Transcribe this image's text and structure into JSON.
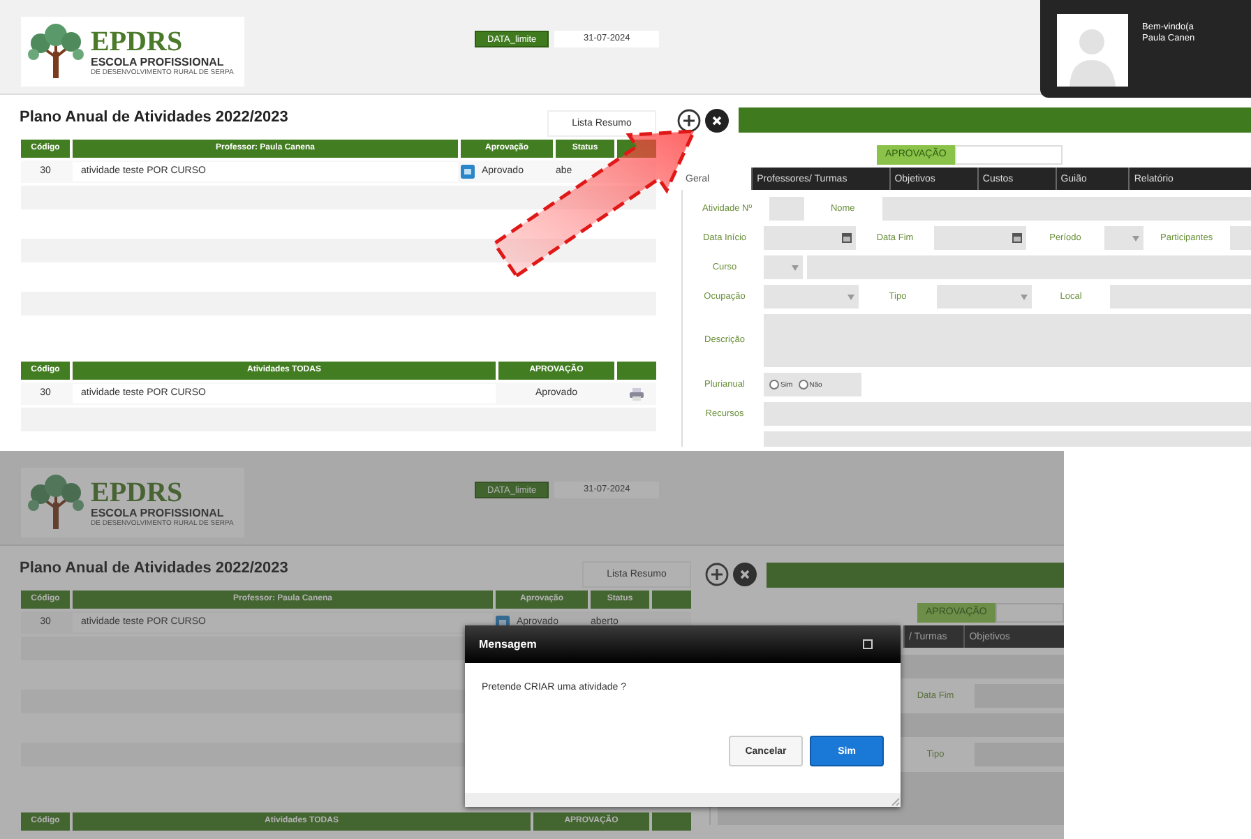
{
  "screens": [
    {
      "header": {
        "logo": {
          "name": "EPDRS",
          "subtitle": "ESCOLA PROFISSIONAL",
          "tagline": "DE DESENVOLVIMENTO RURAL DE SERPA"
        },
        "date_label": "DATA_limite",
        "date_value": "31-07-2024",
        "user": {
          "greeting": "Bem-vindo(a",
          "name": "Paula Canen"
        }
      },
      "title": "Plano Anual de Atividades 2022/2023",
      "summary_button": "Lista Resumo",
      "activities_table": {
        "columns": [
          "Código",
          "Professor: Paula Canena",
          "Aprovação",
          "Status"
        ],
        "rows": [
          {
            "code": "30",
            "name": "atividade teste POR CURSO",
            "approval": "Aprovado",
            "status": "abe"
          }
        ]
      },
      "all_table": {
        "columns": [
          "Código",
          "Atividades TODAS",
          "APROVAÇÃO"
        ],
        "rows": [
          {
            "code": "30",
            "name": "atividade teste POR CURSO",
            "approval": "Aprovado"
          }
        ]
      },
      "form": {
        "badge": "APROVAÇÃO",
        "tabs": [
          {
            "label": "Geral",
            "selected": true
          },
          {
            "label": "Professores/ Turmas",
            "selected": false
          },
          {
            "label": "Objetivos",
            "selected": false
          },
          {
            "label": "Custos",
            "selected": false
          },
          {
            "label": "Guião",
            "selected": false
          },
          {
            "label": "Relatório",
            "selected": false
          }
        ],
        "rows": [
          {
            "items": [
              {
                "kind": "label",
                "text": "Atividade Nº"
              },
              {
                "kind": "short-field"
              },
              {
                "kind": "label",
                "text": "Nome"
              },
              {
                "kind": "field"
              }
            ]
          },
          {
            "items": [
              {
                "kind": "label",
                "text": "Data Início"
              },
              {
                "kind": "date-field"
              },
              {
                "kind": "label",
                "text": "Data Fim"
              },
              {
                "kind": "date-field"
              },
              {
                "kind": "label",
                "text": "Período"
              },
              {
                "kind": "short-select"
              },
              {
                "kind": "label",
                "text": "Participantes"
              },
              {
                "kind": "field"
              }
            ]
          },
          {
            "items": [
              {
                "kind": "label",
                "text": "Curso"
              },
              {
                "kind": "short-select"
              },
              {
                "kind": "field"
              }
            ]
          },
          {
            "items": [
              {
                "kind": "label",
                "text": "Ocupação"
              },
              {
                "kind": "select-field"
              },
              {
                "kind": "label",
                "text": "Tipo"
              },
              {
                "kind": "select-field"
              },
              {
                "kind": "label",
                "text": "Local"
              },
              {
                "kind": "field"
              }
            ]
          },
          {
            "items": [
              {
                "kind": "tall-label",
                "text": "Descrição"
              },
              {
                "kind": "text-area"
              }
            ]
          },
          {
            "items": [
              {
                "kind": "label",
                "text": "Plurianual"
              },
              {
                "kind": "radio-group",
                "options": [
                  {
                    "label": "Sim",
                    "selected": false
                  },
                  {
                    "label": "Não",
                    "selected": false
                  }
                ]
              }
            ]
          },
          {
            "items": [
              {
                "kind": "label",
                "text": "Recursos"
              },
              {
                "kind": "field"
              }
            ]
          },
          {
            "items": [
              {
                "kind": "tall-label"
              },
              {
                "kind": "text-area"
              }
            ]
          }
        ]
      },
      "annotation": {
        "kind": "arrow"
      }
    },
    {
      "header": {
        "logo": {
          "name": "EPDRS",
          "subtitle": "ESCOLA PROFISSIONAL",
          "tagline": "DE DESENVOLVIMENTO RURAL DE SERPA"
        },
        "date_label": "DATA_limite",
        "date_value": "31-07-2024"
      },
      "title": "Plano Anual de Atividades 2022/2023",
      "summary_button": "Lista Resumo",
      "activities_table": {
        "columns": [
          "Código",
          "Professor: Paula Canena",
          "Aprovação",
          "Status"
        ],
        "rows": [
          {
            "code": "30",
            "name": "atividade teste POR CURSO",
            "approval": "Aprovado",
            "status": "aberto"
          }
        ]
      },
      "all_table": {
        "columns": [
          "Código",
          "Atividades TODAS",
          "APROVAÇÃO"
        ]
      },
      "form": {
        "badge": "APROVAÇÃO",
        "tabs": [
          {
            "label": "/ Turmas",
            "selected": false
          },
          {
            "label": "Objetivos",
            "selected": false
          }
        ],
        "rows": [
          {
            "items": [
              {
                "kind": "field"
              }
            ]
          },
          {
            "items": [
              {
                "kind": "wide-field"
              },
              {
                "kind": "label",
                "text": "Data Fim"
              },
              {
                "kind": "field"
              }
            ]
          },
          {
            "items": [
              {
                "kind": "field"
              }
            ]
          },
          {
            "items": [
              {
                "kind": "wide-field"
              },
              {
                "kind": "label",
                "text": "Tipo"
              },
              {
                "kind": "field"
              }
            ]
          },
          {
            "items": [
              {
                "kind": "text-area"
              }
            ]
          }
        ]
      },
      "dialog": {
        "title": "Mensagem",
        "message": "Pretende CRIAR uma atividade ?",
        "buttons": [
          {
            "label": "Cancelar",
            "kind": "secondary"
          },
          {
            "label": "Sim",
            "kind": "primary"
          }
        ]
      }
    }
  ]
}
